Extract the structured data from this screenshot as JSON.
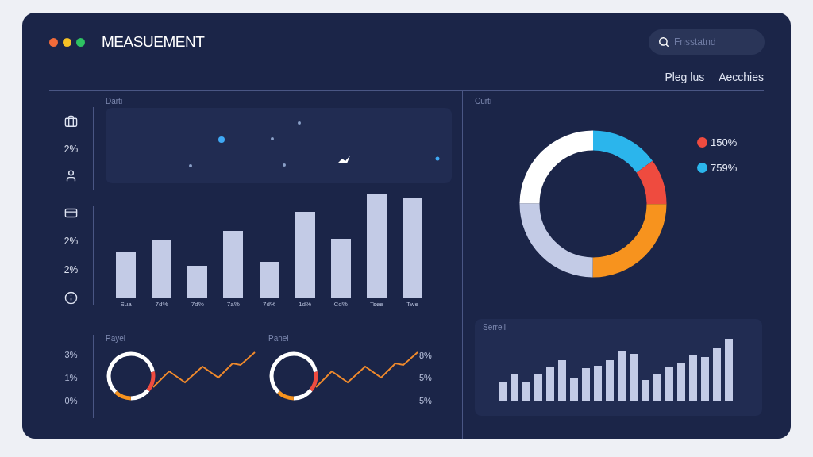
{
  "window": {
    "title": "MEASUEMENT"
  },
  "search": {
    "placeholder": "Fnsstatnd"
  },
  "nav": [
    "Pleg lus",
    "Aecchies"
  ],
  "scatter_panel": {
    "title": "Darti",
    "rail": [
      "2%"
    ]
  },
  "bar_panel": {
    "rail": [
      "2%",
      "2%"
    ],
    "x_labels": [
      "Sua",
      "7d%",
      "7d%",
      "7a%",
      "7d%",
      "1d%",
      "Cd%",
      "Tsee",
      "Twe"
    ]
  },
  "donut_panel": {
    "title": "Curti",
    "legend": [
      {
        "label": "150%",
        "color": "#ef4b3f"
      },
      {
        "label": "759%",
        "color": "#2bb5ec"
      }
    ]
  },
  "bottom_rail": [
    "3%",
    "1%",
    "0%"
  ],
  "mini_panels": [
    {
      "title": "Payel"
    },
    {
      "title": "Panel"
    }
  ],
  "mini_axis": [
    "8%",
    "5%",
    "5%"
  ],
  "trend_panel": {
    "title": "Serrell"
  }
}
